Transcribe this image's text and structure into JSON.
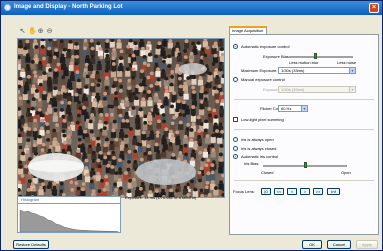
{
  "window": {
    "title": "Image and Display - North Parking Lot"
  },
  "toolbar": {
    "icons": [
      "select-icon",
      "pan-icon",
      "zoom-in-icon",
      "zoom-out-icon"
    ]
  },
  "histogram": {
    "tab_label": "Histogram"
  },
  "exposure_readout": "Exposure: 14 ms (1/70.661 of a second)",
  "tabs": [
    {
      "label": "Image Acquisition"
    }
  ],
  "acquisition": {
    "auto_exposure_label": "Automatic exposure control",
    "exposure_bias_label": "Exposure Bias:",
    "bias_low": "Less motion blur",
    "bias_high": "Less noise",
    "max_exposure_label": "Maximum Exposure:",
    "max_exposure_value": "1/30s (33ms)",
    "manual_exposure_label": "Manual exposure control",
    "exposure_label": "Exposure:",
    "exposure_value": "1/30s (33ms)",
    "flicker_label": "Flicker Control:",
    "flicker_value": "60 Hz",
    "lowlight_label": "Low-light pixel summing"
  },
  "iris": {
    "always_open": "Iris is always open",
    "always_closed": "Iris is always closed",
    "auto_control": "Automatic iris control",
    "iris_bias_label": "Iris Bias:",
    "closed_label": "Closed",
    "open_label": "Open"
  },
  "focus": {
    "label": "Focus Lens:",
    "buttons": [
      "|0",
      "<<",
      "<",
      ">",
      ">>",
      "Inf"
    ]
  },
  "footer": {
    "restore_defaults": "Restore Defaults",
    "ok": "OK",
    "cancel": "Cancel",
    "apply": "Apply"
  },
  "colors": {
    "title_bar": "#0a5fc2",
    "tab_accent": "#f0a020",
    "link_blue": "#3366cc"
  }
}
